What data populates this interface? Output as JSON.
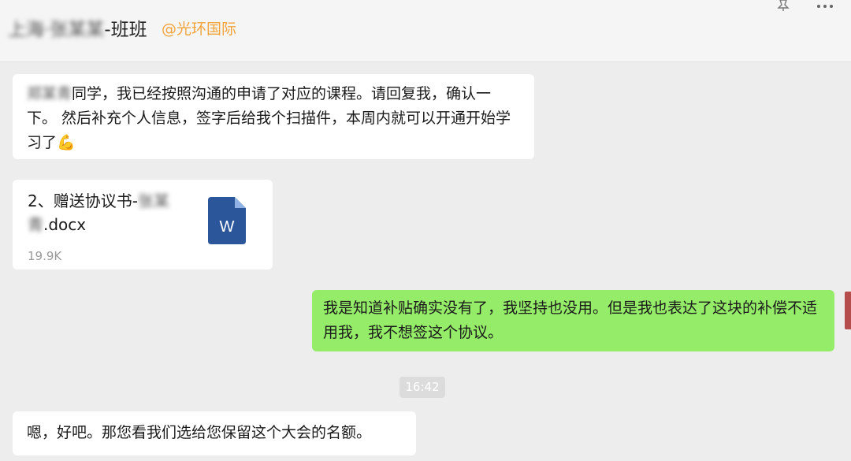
{
  "header": {
    "title_blurred": "上海·张某某",
    "title_suffix": "-班班",
    "org": "@光环国际"
  },
  "messages": {
    "msg1": {
      "blurred_name": "郑某青",
      "text": "同学，我已经按照沟通的申请了对应的课程。请回复我，确认一下。 然后补充个人信息，签字后给我个扫描件，本周内就可以开通开始学习了",
      "emoji": "💪"
    },
    "file": {
      "name_prefix": "2、赠送协议书-",
      "name_blurred": "张某青",
      "name_suffix": ".docx",
      "size": "19.9K",
      "icon": "word-file-icon",
      "icon_color": "#2b579a"
    },
    "outgoing": {
      "text": "我是知道补贴确实没有了，我坚持也没用。但是我也表达了这块的补偿不适用我，我不想签这个协议。",
      "bubble_color": "#95ec69"
    },
    "timestamp": "16:42",
    "last": {
      "text": "嗯，好吧。那您看我们选给您保留这个大会的名额。"
    }
  }
}
